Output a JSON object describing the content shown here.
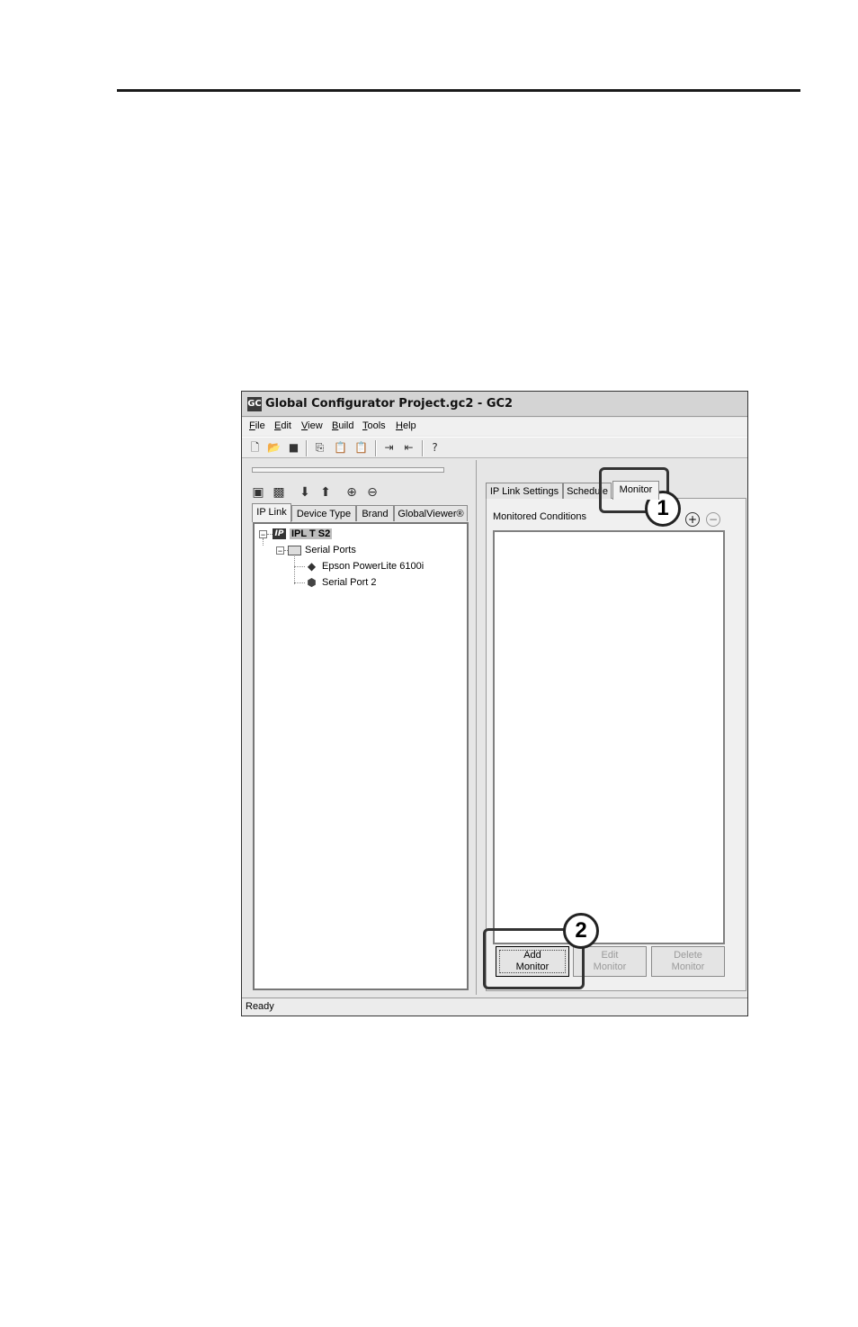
{
  "window": {
    "app_icon": "GC",
    "title": "Global Configurator Project.gc2 - GC2"
  },
  "menu": [
    "File",
    "Edit",
    "View",
    "Build",
    "Tools",
    "Help"
  ],
  "toolbar_icons": [
    "new-file-icon",
    "open-folder-icon",
    "save-icon",
    "copy-icon",
    "paste-icon",
    "paste-special-icon",
    "export-icon",
    "import-icon",
    "help-icon"
  ],
  "left_pane": {
    "action_icons": [
      "add-device-icon",
      "remove-device-icon",
      "move-down-icon",
      "move-up-icon",
      "expand-all-icon",
      "collapse-all-icon"
    ],
    "tabs": [
      "IP Link",
      "Device Type",
      "Brand",
      "GlobalViewer®"
    ],
    "active_tab": "IP Link",
    "tree": {
      "root": "IPL T S2",
      "root_icon_text": "IP",
      "folder": "Serial Ports",
      "children": [
        "Epson PowerLite 6100i",
        "Serial Port 2"
      ]
    }
  },
  "right_pane": {
    "tabs": [
      "IP Link Settings",
      "Schedule",
      "Monitor"
    ],
    "active_tab": "Monitor",
    "monitored_label": "Monitored Conditions",
    "buttons": {
      "add": "Add\nMonitor",
      "edit": "Edit\nMonitor",
      "delete": "Delete\nMonitor"
    }
  },
  "callouts": [
    "1",
    "2"
  ],
  "status": "Ready"
}
